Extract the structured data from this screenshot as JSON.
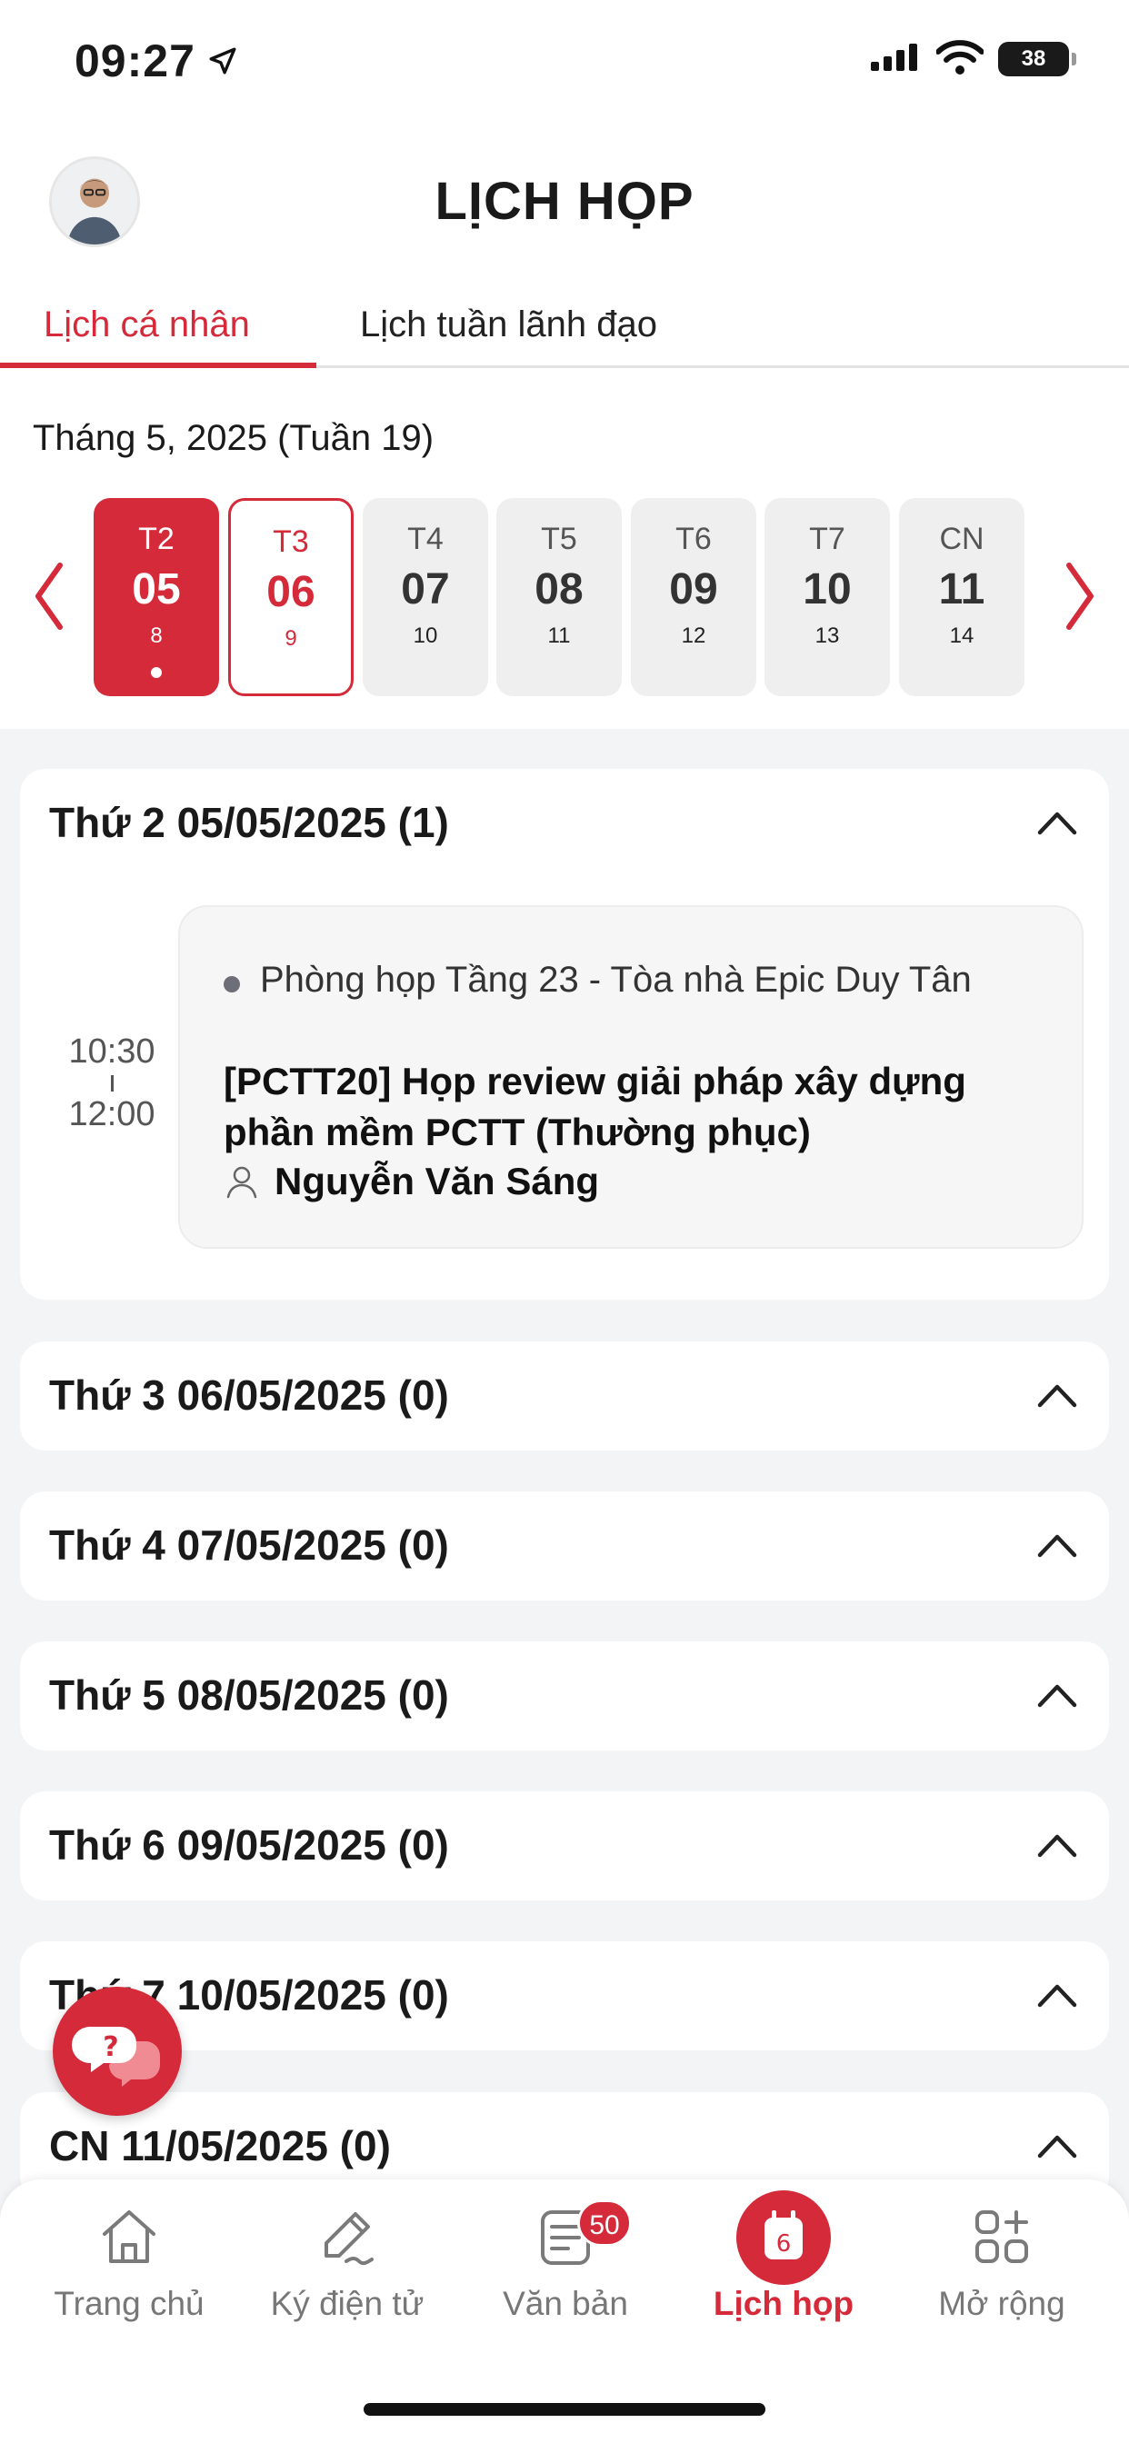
{
  "status_bar": {
    "time": "09:27",
    "battery": "38"
  },
  "header": {
    "title": "LỊCH HỌP"
  },
  "tabs": [
    {
      "label": "Lịch cá nhân",
      "active": true
    },
    {
      "label": "Lịch tuần lãnh đạo",
      "active": false
    }
  ],
  "week": {
    "month_label": "Tháng 5, 2025 (Tuần 19)",
    "days": [
      {
        "dow": "T2",
        "day": "05",
        "lunar": "8",
        "state": "selected",
        "has_event": true
      },
      {
        "dow": "T3",
        "day": "06",
        "lunar": "9",
        "state": "today",
        "has_event": false
      },
      {
        "dow": "T4",
        "day": "07",
        "lunar": "10",
        "state": "normal",
        "has_event": false
      },
      {
        "dow": "T5",
        "day": "08",
        "lunar": "11",
        "state": "normal",
        "has_event": false
      },
      {
        "dow": "T6",
        "day": "09",
        "lunar": "12",
        "state": "normal",
        "has_event": false
      },
      {
        "dow": "T7",
        "day": "10",
        "lunar": "13",
        "state": "normal",
        "has_event": false
      },
      {
        "dow": "CN",
        "day": "11",
        "lunar": "14",
        "state": "normal",
        "has_event": false
      }
    ]
  },
  "sections": [
    {
      "title": "Thứ 2 05/05/2025 (1)",
      "event": {
        "start": "10:30",
        "end": "12:00",
        "room": "Phòng họp Tầng 23  - Tòa nhà Epic Duy Tân",
        "title": "[PCTT20] Họp review giải pháp xây dựng phần mềm PCTT (Thường phục)",
        "host": "Nguyễn Văn Sáng"
      }
    },
    {
      "title": "Thứ 3 06/05/2025 (0)"
    },
    {
      "title": "Thứ 4 07/05/2025 (0)"
    },
    {
      "title": "Thứ 5 08/05/2025 (0)"
    },
    {
      "title": "Thứ 6 09/05/2025 (0)"
    },
    {
      "title": "Thứ 7 10/05/2025 (0)"
    },
    {
      "title": "CN 11/05/2025 (0)"
    }
  ],
  "bottom_nav": [
    {
      "label": "Trang chủ",
      "icon": "home-icon"
    },
    {
      "label": "Ký điện tử",
      "icon": "pen-sign-icon"
    },
    {
      "label": "Văn bản",
      "icon": "document-icon",
      "badge": "50"
    },
    {
      "label": "Lịch họp",
      "icon": "calendar-icon",
      "active": true,
      "icon_number": "6"
    },
    {
      "label": "Mở rộng",
      "icon": "apps-grid-icon"
    }
  ],
  "colors": {
    "accent": "#d42a3a",
    "background": "#f3f4f6",
    "card": "#ffffff"
  }
}
